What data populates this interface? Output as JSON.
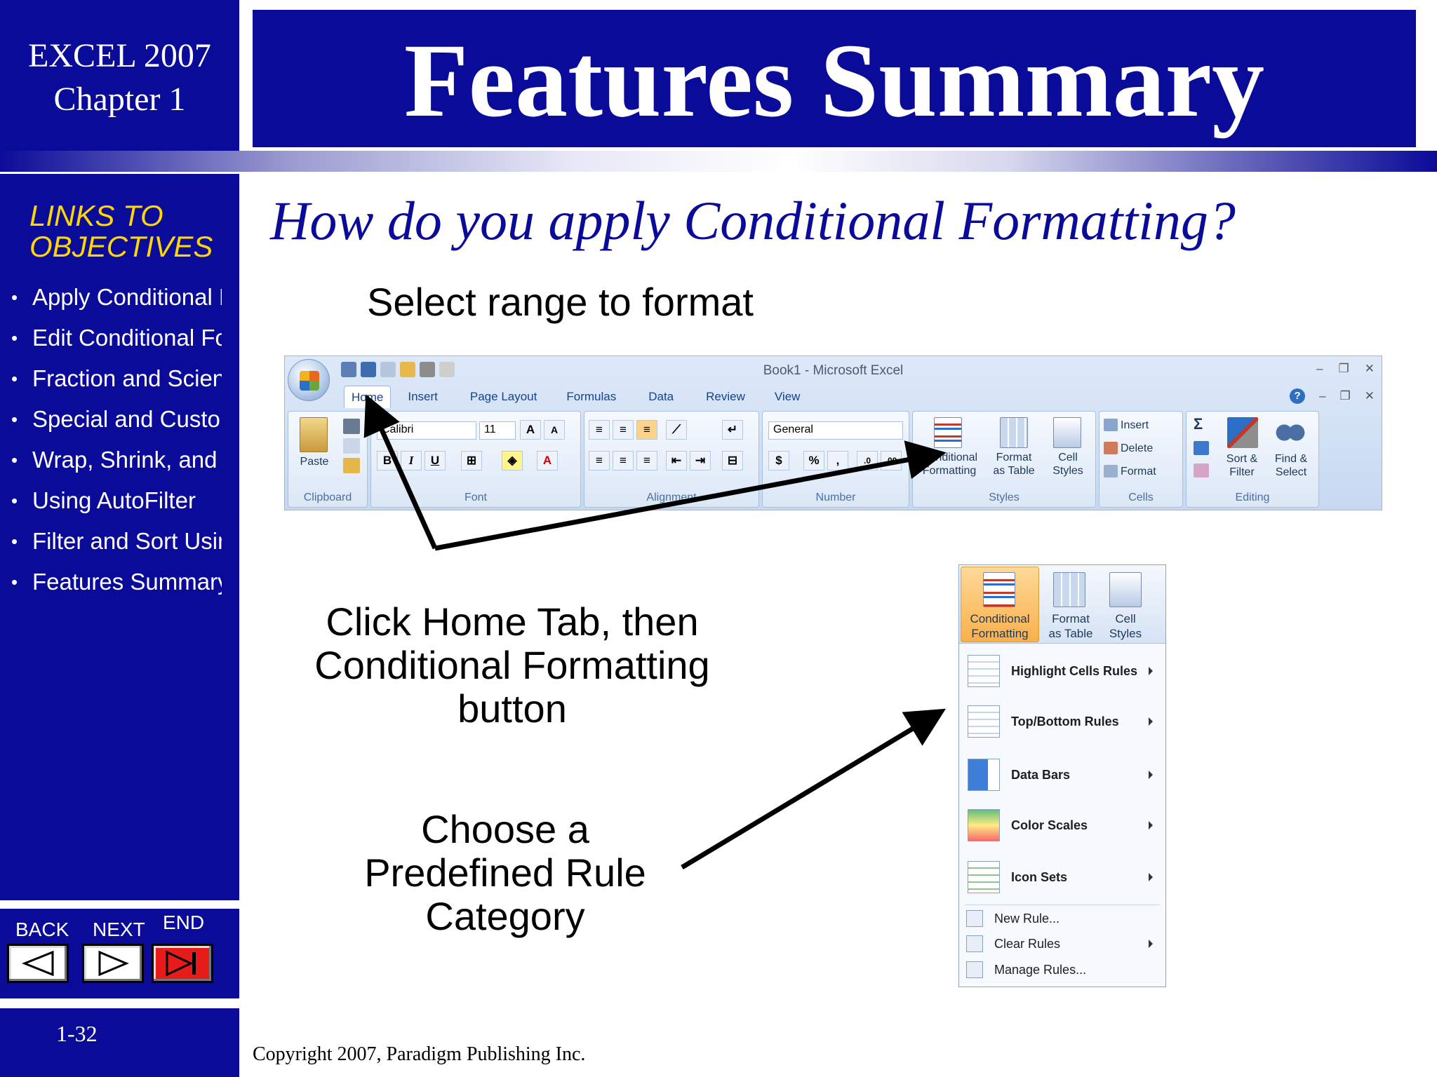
{
  "sidebar": {
    "course_line1": "EXCEL 2007",
    "course_line2": "Chapter 1",
    "links_heading_line1": "LINKS TO",
    "links_heading_line2": "OBJECTIVES",
    "links": [
      "Apply Conditional Fo",
      "Edit Conditional Form",
      "Fraction and Scientifi",
      "Special and Custom",
      "Wrap, Shrink, and Me",
      "Using AutoFilter",
      "Filter and Sort Using",
      "Features Summary"
    ],
    "nav": {
      "back": "BACK",
      "next": "NEXT",
      "end": "END"
    },
    "page_number": "1-32"
  },
  "title": "Features Summary",
  "question": "How do you apply Conditional Formatting?",
  "steps": {
    "step1": "Select range to format",
    "step2_lines": [
      "Click Home Tab, then",
      "Conditional Formatting",
      "button"
    ],
    "step3_lines": [
      "Choose a",
      "Predefined Rule",
      "Category"
    ]
  },
  "copyright": "Copyright 2007, Paradigm Publishing Inc.",
  "ribbon": {
    "app_title": "Book1  -  Microsoft Excel",
    "tabs": [
      "Home",
      "Insert",
      "Page Layout",
      "Formulas",
      "Data",
      "Review",
      "View"
    ],
    "active_tab": "Home",
    "groups": {
      "clipboard": "Clipboard",
      "font": "Font",
      "alignment": "Alignment",
      "number": "Number",
      "styles": "Styles",
      "cells": "Cells",
      "editing": "Editing"
    },
    "paste": "Paste",
    "font_name": "Calibri",
    "font_size": "11",
    "number_format": "General",
    "cf_line1": "Conditional",
    "cf_line2": "Formatting",
    "fat_line1": "Format",
    "fat_line2": "as Table",
    "cs_line1": "Cell",
    "cs_line2": "Styles",
    "insert": "Insert",
    "delete": "Delete",
    "format": "Format",
    "sort_line1": "Sort &",
    "sort_line2": "Filter",
    "find_line1": "Find &",
    "find_line2": "Select"
  },
  "cf_menu": {
    "top": {
      "cf_line1": "Conditional",
      "cf_line2": "Formatting",
      "fat_line1": "Format",
      "fat_line2": "as Table",
      "cs_line1": "Cell",
      "cs_line2": "Styles"
    },
    "items": [
      "Highlight Cells Rules",
      "Top/Bottom Rules",
      "Data Bars",
      "Color Scales",
      "Icon Sets"
    ],
    "actions": [
      "New Rule...",
      "Clear Rules",
      "Manage Rules..."
    ]
  },
  "colors": {
    "navy": "#0b0b99",
    "link_heading": "#ffd700",
    "end_button": "#e81b1b",
    "highlight": "#f9b04a"
  }
}
